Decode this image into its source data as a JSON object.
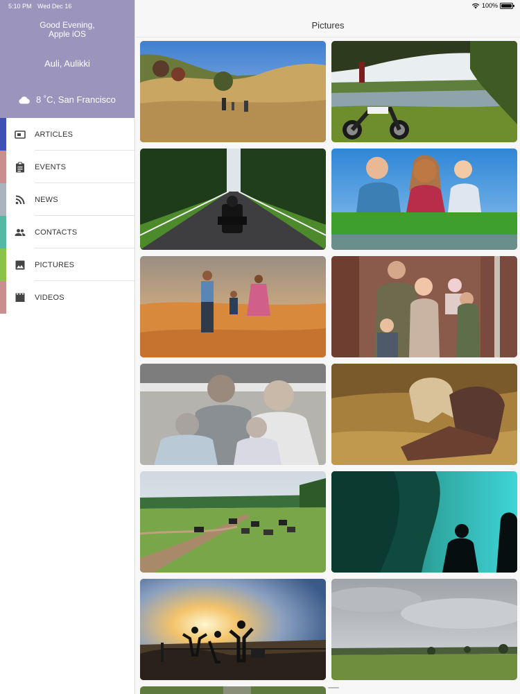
{
  "status_bar": {
    "time": "5:10 PM",
    "date": "Wed Dec 16",
    "battery": "100%",
    "battery_level": 1.0
  },
  "sidebar": {
    "greeting_line1": "Good Evening,",
    "greeting_line2": "Apple iOS",
    "user_name": "Auli, Aulikki",
    "weather": "8 ˚C, San Francisco",
    "header_color": "#9b95bd",
    "menu": [
      {
        "label": "ARTICLES",
        "icon": "article-icon",
        "color": "#3f51b5"
      },
      {
        "label": "EVENTS",
        "icon": "clipboard-icon",
        "color": "#c98f8f"
      },
      {
        "label": "NEWS",
        "icon": "rss-icon",
        "color": "#a9b4bc"
      },
      {
        "label": "CONTACTS",
        "icon": "people-icon",
        "color": "#54b9a3"
      },
      {
        "label": "PICTURES",
        "icon": "image-icon",
        "color": "#8bc34a"
      },
      {
        "label": "VIDEOS",
        "icon": "film-icon",
        "color": "#c98f8f"
      }
    ]
  },
  "main": {
    "title": "Pictures",
    "pictures": [
      "family-walking-field",
      "motorcycle-by-lake",
      "motorcycle-on-road",
      "family-on-grass",
      "family-walking-sunset",
      "family-in-autumn-forest",
      "family-on-beach",
      "girl-in-hay",
      "motorcycles-in-meadow",
      "underwater-silhouette",
      "friends-at-sunset",
      "cloudy-landscape",
      "partial-photo"
    ]
  }
}
